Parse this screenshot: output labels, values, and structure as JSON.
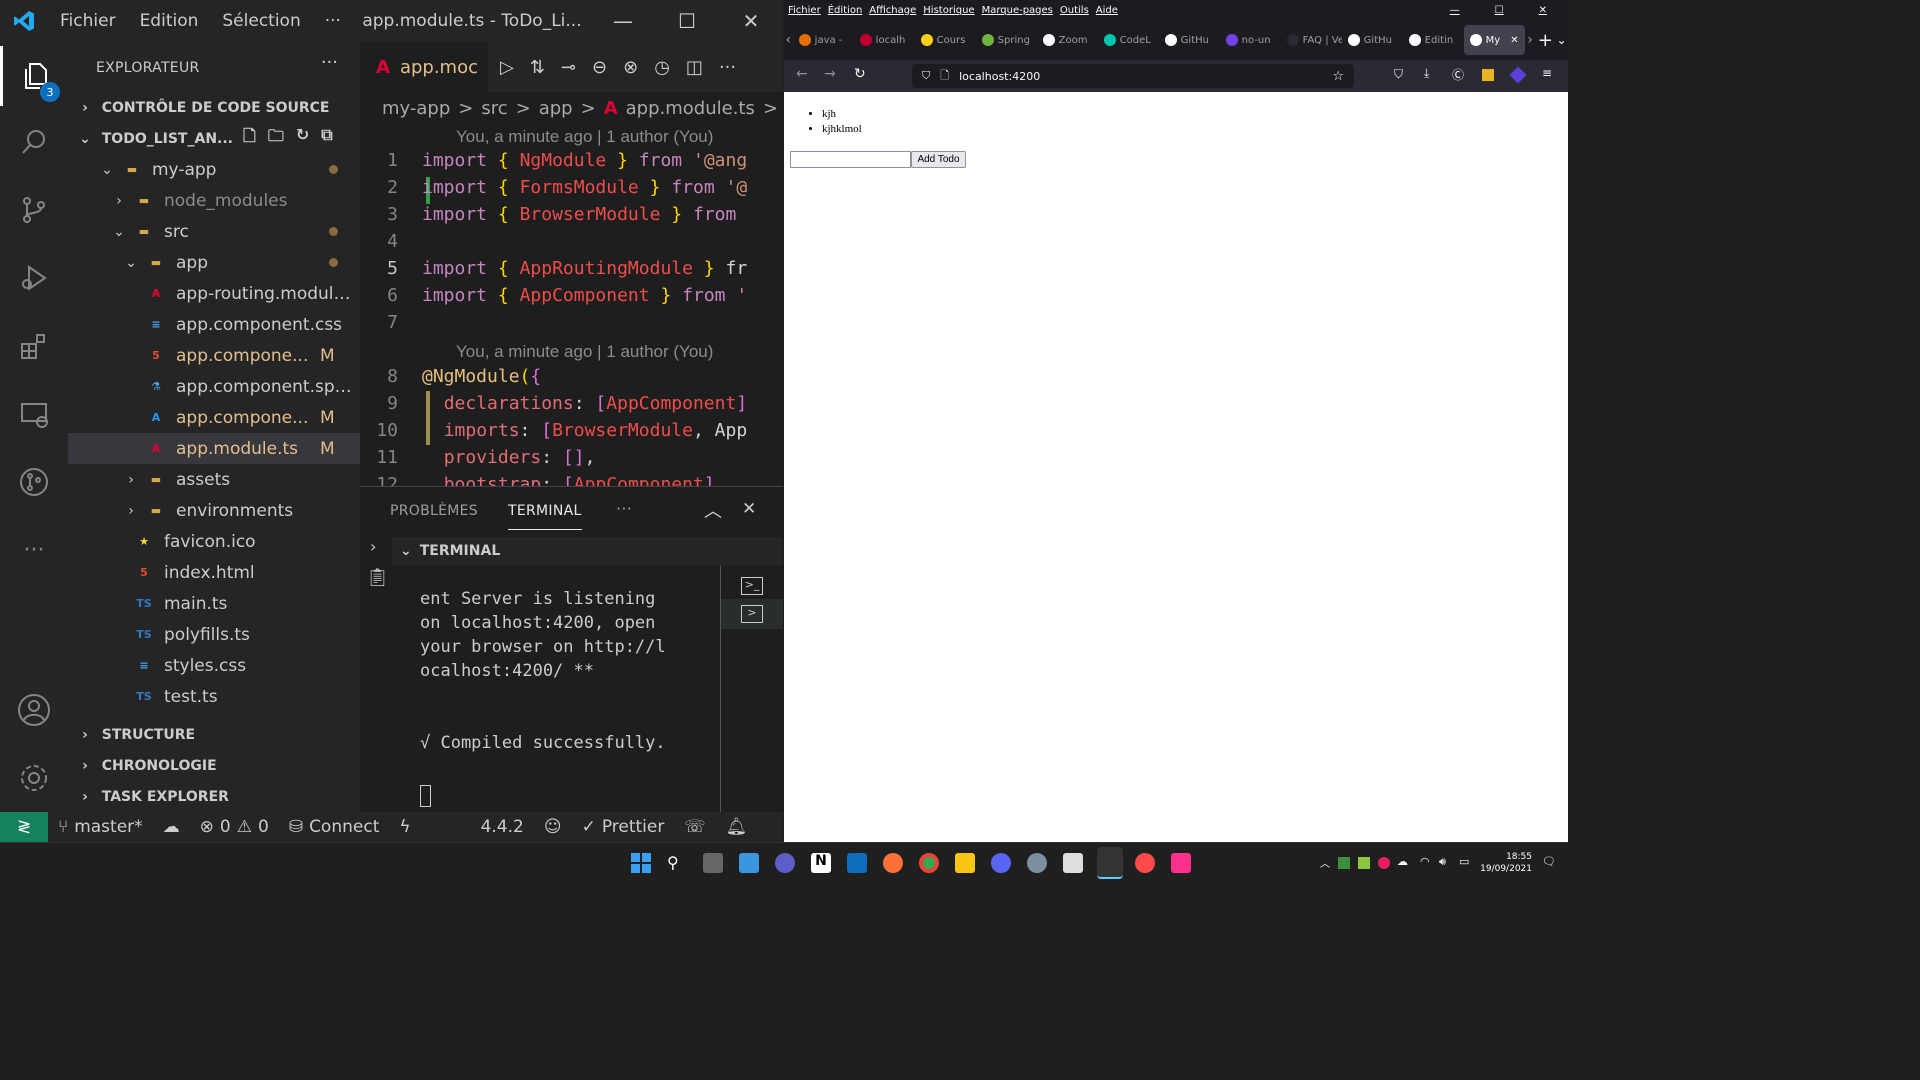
{
  "vscode": {
    "menu": [
      "Fichier",
      "Edition",
      "Sélection",
      "···"
    ],
    "window_title": "app.module.ts - ToDo_Li...",
    "activity_badge": "3",
    "explorer": {
      "header": "EXPLORATEUR",
      "source_control": "CONTRÔLE DE CODE SOURCE",
      "project": "TODO_LIST_AN...",
      "tree": [
        {
          "label": "my-app",
          "depth": 1,
          "type": "folder-open"
        },
        {
          "label": "node_modules",
          "depth": 2,
          "type": "folder"
        },
        {
          "label": "src",
          "depth": 2,
          "type": "folder-open"
        },
        {
          "label": "app",
          "depth": 3,
          "type": "folder-open"
        },
        {
          "label": "app-routing.module...",
          "depth": 4,
          "type": "angular"
        },
        {
          "label": "app.component.css",
          "depth": 4,
          "type": "css"
        },
        {
          "label": "app.compone...",
          "depth": 4,
          "type": "html",
          "status": "M"
        },
        {
          "label": "app.component.spe...",
          "depth": 4,
          "type": "test"
        },
        {
          "label": "app.compone...",
          "depth": 4,
          "type": "ts-angular",
          "status": "M"
        },
        {
          "label": "app.module.ts",
          "depth": 4,
          "type": "angular",
          "status": "M"
        },
        {
          "label": "assets",
          "depth": 3,
          "type": "folder"
        },
        {
          "label": "environments",
          "depth": 3,
          "type": "folder"
        },
        {
          "label": "favicon.ico",
          "depth": 3,
          "type": "star"
        },
        {
          "label": "index.html",
          "depth": 3,
          "type": "html"
        },
        {
          "label": "main.ts",
          "depth": 3,
          "type": "ts"
        },
        {
          "label": "polyfills.ts",
          "depth": 3,
          "type": "ts"
        },
        {
          "label": "styles.css",
          "depth": 3,
          "type": "css"
        },
        {
          "label": "test.ts",
          "depth": 3,
          "type": "ts"
        }
      ],
      "sections": [
        "STRUCTURE",
        "CHRONOLOGIE",
        "TASK EXPLORER"
      ]
    },
    "tab_label": "app.moc",
    "breadcrumb": [
      "my-app",
      ">",
      "src",
      ">",
      "app",
      ">",
      "app.module.ts",
      ">",
      "..."
    ],
    "blame": "You, a minute ago | 1 author (You)",
    "code": [
      {
        "n": "1",
        "t": "import { NgModule } from '@ang"
      },
      {
        "n": "2",
        "t": "import { FormsModule } from '@"
      },
      {
        "n": "3",
        "t": "import { BrowserModule } from"
      },
      {
        "n": "4",
        "t": ""
      },
      {
        "n": "5",
        "t": "import { AppRoutingModule } fr"
      },
      {
        "n": "6",
        "t": "import { AppComponent } from '"
      },
      {
        "n": "7",
        "t": ""
      },
      {
        "n": "8",
        "t": "@NgModule({"
      },
      {
        "n": "9",
        "t": "  declarations: [AppComponent]"
      },
      {
        "n": "10",
        "t": "  imports: [BrowserModule, App"
      },
      {
        "n": "11",
        "t": "  providers: [],"
      },
      {
        "n": "12",
        "t": "  bootstrap: [AppComponent]"
      }
    ],
    "panel": {
      "tabs": [
        "PROBLÈMES",
        "TERMINAL",
        "···"
      ],
      "terminal_header": "TERMINAL",
      "output": "ent Server is listening\non localhost:4200, open\nyour browser on http://l\nocalhost:4200/ **\n\n\n√ Compiled successfully."
    },
    "status": {
      "branch": "master*",
      "errors": "0",
      "warnings": "0",
      "connect": "Connect",
      "version": "4.4.2",
      "prettier": "Prettier"
    }
  },
  "firefox": {
    "menu": [
      "Fichier",
      "Édition",
      "Affichage",
      "Historique",
      "Marque-pages",
      "Outils",
      "Aide"
    ],
    "tabs": [
      {
        "label": "java -",
        "color": "#e76f00"
      },
      {
        "label": "localh",
        "color": "#c3002f"
      },
      {
        "label": "Cours",
        "color": "#fcd116"
      },
      {
        "label": "Spring",
        "color": "#6db33f"
      },
      {
        "label": "Zoom",
        "color": "#ffffff"
      },
      {
        "label": "CodeL",
        "color": "#00c6ae"
      },
      {
        "label": "GitHu",
        "color": "#ffffff"
      },
      {
        "label": "no-un",
        "color": "#7542e5"
      },
      {
        "label": "FAQ | Vetu",
        "color": "#2b2a33"
      },
      {
        "label": "GitHu",
        "color": "#ffffff"
      },
      {
        "label": "Editin",
        "color": "#ffffff"
      },
      {
        "label": "My",
        "color": "#ffffff"
      }
    ],
    "url": "localhost:4200",
    "page": {
      "todos": [
        "kjh",
        "kjhklmol"
      ],
      "input_value": "",
      "button": "Add Todo"
    }
  },
  "taskbar": {
    "time": "18:55",
    "date": "19/09/2021"
  }
}
